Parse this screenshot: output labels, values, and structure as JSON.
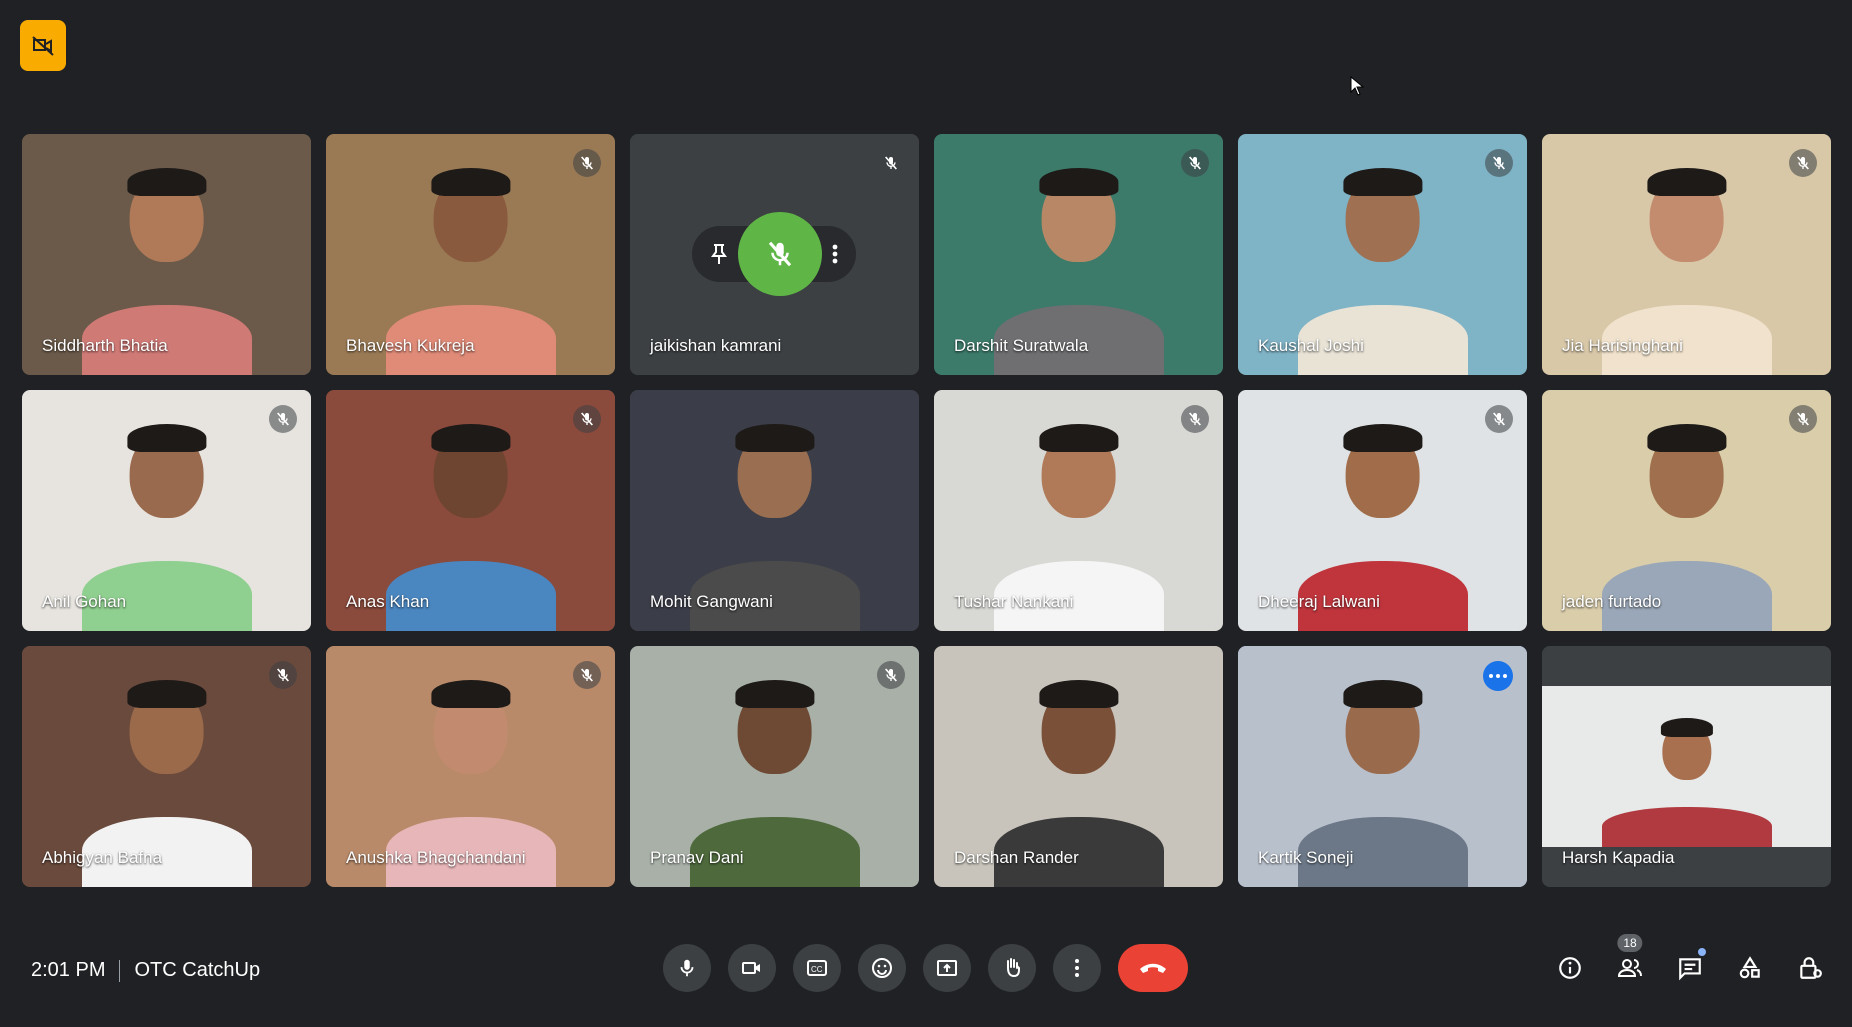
{
  "meeting": {
    "time": "2:01 PM",
    "title": "OTC CatchUp"
  },
  "participant_count": "18",
  "participants": [
    {
      "name": "Siddharth Bhatia",
      "muted": false,
      "bg": "#6b5a4a",
      "skin": "#b07a58",
      "shirt": "#d07a76"
    },
    {
      "name": "Bhavesh Kukreja",
      "muted": true,
      "bg": "#9a7a55",
      "skin": "#8a5a3e",
      "shirt": "#e08b78"
    },
    {
      "name": "jaikishan kamrani",
      "muted": true,
      "bg": "#3c4043",
      "skin": "",
      "shirt": "",
      "no_video": true
    },
    {
      "name": "Darshit Suratwala",
      "muted": true,
      "bg": "#3c7a6a",
      "skin": "#b88866",
      "shirt": "#6f6f72"
    },
    {
      "name": "Kaushal Joshi",
      "muted": true,
      "bg": "#7fb3c6",
      "skin": "#a07052",
      "shirt": "#e9e3d6"
    },
    {
      "name": "Jia Harisinghani",
      "muted": true,
      "bg": "#d8c8a8",
      "skin": "#c48c6e",
      "shirt": "#f0e2cc"
    },
    {
      "name": "Anil Gohan",
      "muted": true,
      "bg": "#e7e4df",
      "skin": "#9a6a4e",
      "shirt": "#8fcf8f"
    },
    {
      "name": "Anas Khan",
      "muted": true,
      "bg": "#8a4a3c",
      "skin": "#6e4530",
      "shirt": "#4a86c0"
    },
    {
      "name": "Mohit Gangwani",
      "muted": false,
      "bg": "#3b3d48",
      "skin": "#9a6e50",
      "shirt": "#4b4b4b"
    },
    {
      "name": "Tushar Nankani",
      "muted": true,
      "bg": "#d8d8d4",
      "skin": "#b07a58",
      "shirt": "#f5f5f5"
    },
    {
      "name": "Dheeraj Lalwani",
      "muted": true,
      "bg": "#dfe3e5",
      "skin": "#a06c4a",
      "shirt": "#c0353c"
    },
    {
      "name": "jaden furtado",
      "muted": true,
      "bg": "#d9cdaa",
      "skin": "#a0704e",
      "shirt": "#9aa7b8"
    },
    {
      "name": "Abhigyan Bafna",
      "muted": true,
      "bg": "#6a4a3c",
      "skin": "#9a6a4a",
      "shirt": "#f2f2f2"
    },
    {
      "name": "Anushka Bhagchandani",
      "muted": true,
      "bg": "#b88a6a",
      "skin": "#c28a6e",
      "shirt": "#e7b6b8"
    },
    {
      "name": "Pranav Dani",
      "muted": true,
      "bg": "#a8b0a8",
      "skin": "#6e4a34",
      "shirt": "#4e6a3c"
    },
    {
      "name": "Darshan Rander",
      "muted": false,
      "bg": "#c8c4bc",
      "skin": "#7a5038",
      "shirt": "#3a3a3a"
    },
    {
      "name": "Kartik Soneji",
      "muted": false,
      "bg": "#b8c0cc",
      "skin": "#9a6a4c",
      "shirt": "#6c7888",
      "active": true
    },
    {
      "name": "Harsh Kapadia",
      "muted": false,
      "bg": "#e8eaea",
      "skin": "#a8704e",
      "shirt": "#b03a40",
      "self": true
    }
  ],
  "controls": [
    "microphone-icon",
    "camera-icon",
    "captions-icon",
    "emoji-icon",
    "present-icon",
    "raise-hand-icon",
    "more-options-icon",
    "hang-up-icon"
  ],
  "right_panel": [
    "info-icon",
    "people-icon",
    "chat-icon",
    "activities-icon",
    "host-controls-icon"
  ],
  "colors": {
    "background": "#202124",
    "tile": "#3c4043",
    "accent": "#8ab4f8",
    "hangup": "#ea4335",
    "badge": "#f9ab00"
  }
}
